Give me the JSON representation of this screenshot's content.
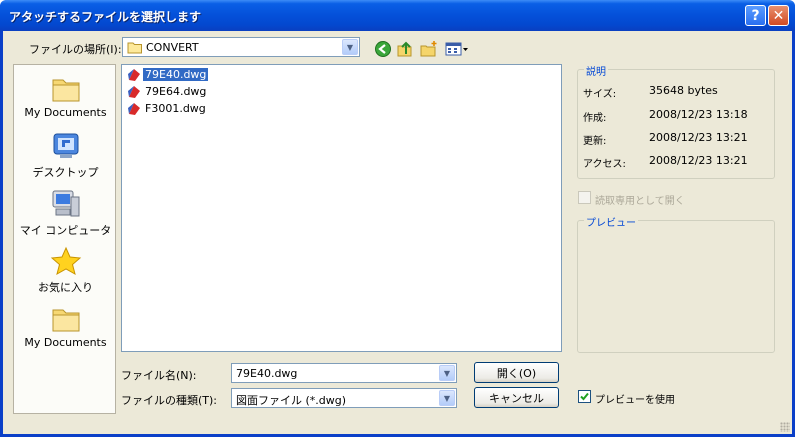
{
  "window": {
    "title": "アタッチするファイルを選択します",
    "help_label": "?",
    "close_label": "✕"
  },
  "toolbar": {
    "lookin_label": "ファイルの場所(I):",
    "lookin_value": "CONVERT",
    "icons": [
      "back-icon",
      "up-folder-icon",
      "new-folder-icon",
      "view-menu-icon"
    ]
  },
  "places": [
    {
      "label": "My Documents",
      "icon": "folder-icon"
    },
    {
      "label": "デスクトップ",
      "icon": "desktop-icon"
    },
    {
      "label": "マイ コンピュータ",
      "icon": "computer-icon"
    },
    {
      "label": "お気に入り",
      "icon": "star-icon"
    },
    {
      "label": "My Documents",
      "icon": "folder-icon"
    }
  ],
  "files": [
    {
      "name": "79E40.dwg",
      "selected": true
    },
    {
      "name": "79E64.dwg",
      "selected": false
    },
    {
      "name": "F3001.dwg",
      "selected": false
    }
  ],
  "filename": {
    "label": "ファイル名(N):",
    "value": "79E40.dwg"
  },
  "filetype": {
    "label": "ファイルの種類(T):",
    "value": "図面ファイル (*.dwg)"
  },
  "buttons": {
    "open_label": "開く(O)",
    "cancel_label": "キャンセル"
  },
  "description": {
    "title": "説明",
    "size_key": "サイズ:",
    "size_value": "35648 bytes",
    "created_key": "作成:",
    "created_value": "2008/12/23 13:18",
    "modified_key": "更新:",
    "modified_value": "2008/12/23 13:21",
    "accessed_key": "アクセス:",
    "accessed_value": "2008/12/23 13:21"
  },
  "readonly_label": "読取専用として開く",
  "preview": {
    "title": "プレビュー",
    "use_preview_label": "プレビューを使用",
    "use_preview_checked": true
  },
  "colors": {
    "title_blue": "#0450d9",
    "selection": "#316ac5",
    "dialog_bg": "#ece9d8"
  }
}
